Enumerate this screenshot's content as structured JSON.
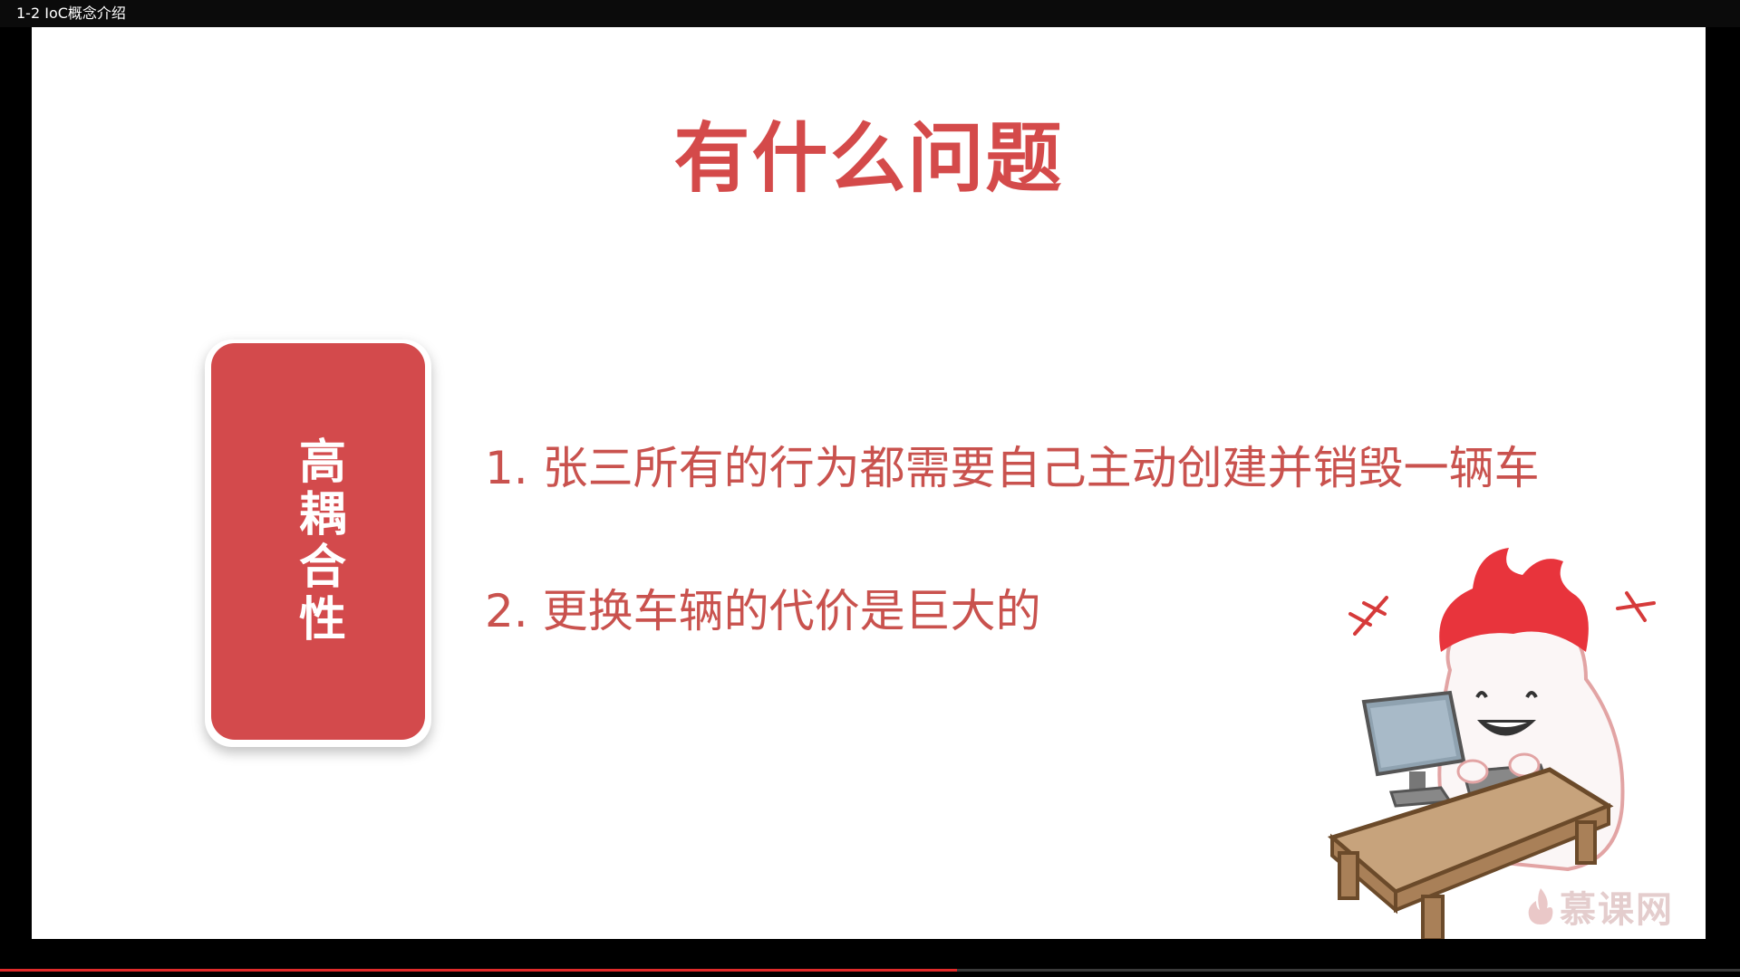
{
  "window": {
    "title": "1-2 IoC概念介绍"
  },
  "slide": {
    "title": "有什么问题",
    "card_label": "高耦合性",
    "points": [
      "1. 张三所有的行为都需要自己主动创建并销毁一辆车",
      "2. 更换车辆的代价是巨大的"
    ],
    "logo_text": "慕课网"
  },
  "player": {
    "progress": 0.55
  },
  "colors": {
    "accent": "#d44a4a",
    "card": "#d34a4c",
    "point_text": "#c9524e"
  }
}
